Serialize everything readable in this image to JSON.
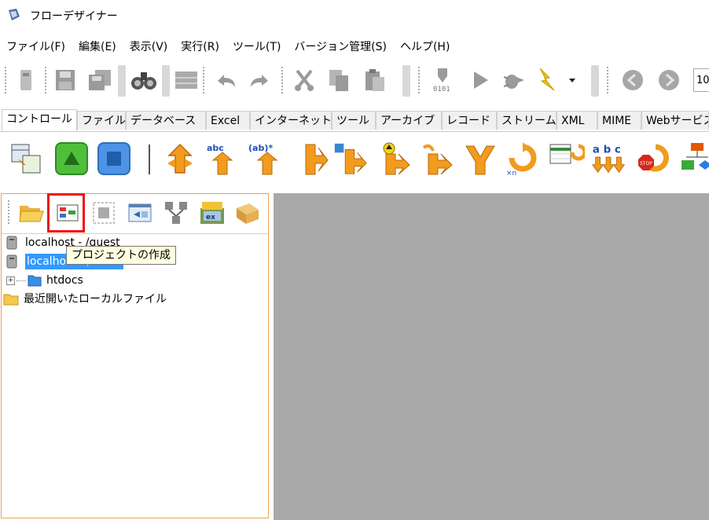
{
  "window": {
    "title": "フローデザイナー"
  },
  "menu": [
    "ファイル(F)",
    "編集(E)",
    "表示(V)",
    "実行(R)",
    "ツール(T)",
    "バージョン管理(S)",
    "ヘルプ(H)"
  ],
  "toolbar": {
    "zoom_value": "10"
  },
  "tabs": [
    "コントロール",
    "ファイル",
    "データベース",
    "Excel",
    "インターネット",
    "ツール",
    "アーカイブ",
    "レコード",
    "ストリーム",
    "XML",
    "MIME",
    "Webサービス"
  ],
  "palette_labels": {
    "abc": "abc",
    "ab_star": "(ab)*",
    "abc_spaced": "a b c",
    "stop": "STOP",
    "xn": "×n"
  },
  "tree": {
    "node1": "localhost - /guest",
    "node2": "localhost - /user1",
    "node3": "htdocs",
    "node4": "最近開いたローカルファイル"
  },
  "tooltip": "プロジェクトの作成",
  "colors": {
    "accent_orange": "#f0a14f",
    "highlight_red": "#ee1111",
    "selection_blue": "#3399ff",
    "canvas_gray": "#a9a9a9"
  }
}
